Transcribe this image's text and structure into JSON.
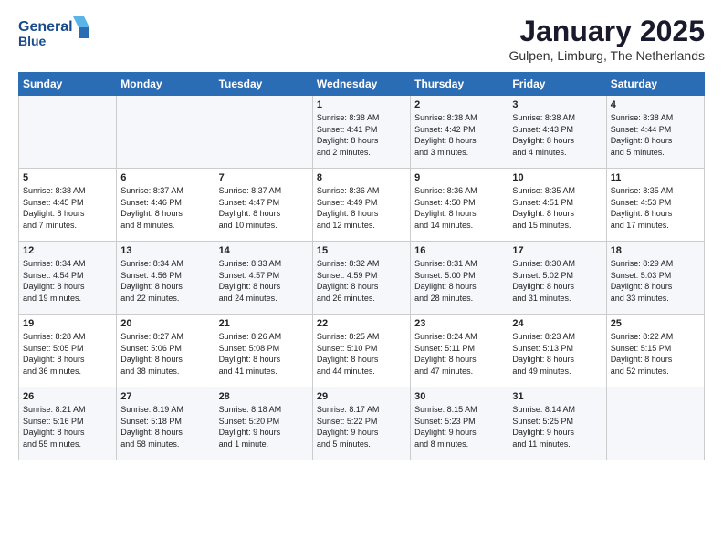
{
  "logo": {
    "line1": "General",
    "line2": "Blue"
  },
  "header": {
    "month": "January 2025",
    "location": "Gulpen, Limburg, The Netherlands"
  },
  "weekdays": [
    "Sunday",
    "Monday",
    "Tuesday",
    "Wednesday",
    "Thursday",
    "Friday",
    "Saturday"
  ],
  "weeks": [
    [
      {
        "day": "",
        "info": ""
      },
      {
        "day": "",
        "info": ""
      },
      {
        "day": "",
        "info": ""
      },
      {
        "day": "1",
        "info": "Sunrise: 8:38 AM\nSunset: 4:41 PM\nDaylight: 8 hours\nand 2 minutes."
      },
      {
        "day": "2",
        "info": "Sunrise: 8:38 AM\nSunset: 4:42 PM\nDaylight: 8 hours\nand 3 minutes."
      },
      {
        "day": "3",
        "info": "Sunrise: 8:38 AM\nSunset: 4:43 PM\nDaylight: 8 hours\nand 4 minutes."
      },
      {
        "day": "4",
        "info": "Sunrise: 8:38 AM\nSunset: 4:44 PM\nDaylight: 8 hours\nand 5 minutes."
      }
    ],
    [
      {
        "day": "5",
        "info": "Sunrise: 8:38 AM\nSunset: 4:45 PM\nDaylight: 8 hours\nand 7 minutes."
      },
      {
        "day": "6",
        "info": "Sunrise: 8:37 AM\nSunset: 4:46 PM\nDaylight: 8 hours\nand 8 minutes."
      },
      {
        "day": "7",
        "info": "Sunrise: 8:37 AM\nSunset: 4:47 PM\nDaylight: 8 hours\nand 10 minutes."
      },
      {
        "day": "8",
        "info": "Sunrise: 8:36 AM\nSunset: 4:49 PM\nDaylight: 8 hours\nand 12 minutes."
      },
      {
        "day": "9",
        "info": "Sunrise: 8:36 AM\nSunset: 4:50 PM\nDaylight: 8 hours\nand 14 minutes."
      },
      {
        "day": "10",
        "info": "Sunrise: 8:35 AM\nSunset: 4:51 PM\nDaylight: 8 hours\nand 15 minutes."
      },
      {
        "day": "11",
        "info": "Sunrise: 8:35 AM\nSunset: 4:53 PM\nDaylight: 8 hours\nand 17 minutes."
      }
    ],
    [
      {
        "day": "12",
        "info": "Sunrise: 8:34 AM\nSunset: 4:54 PM\nDaylight: 8 hours\nand 19 minutes."
      },
      {
        "day": "13",
        "info": "Sunrise: 8:34 AM\nSunset: 4:56 PM\nDaylight: 8 hours\nand 22 minutes."
      },
      {
        "day": "14",
        "info": "Sunrise: 8:33 AM\nSunset: 4:57 PM\nDaylight: 8 hours\nand 24 minutes."
      },
      {
        "day": "15",
        "info": "Sunrise: 8:32 AM\nSunset: 4:59 PM\nDaylight: 8 hours\nand 26 minutes."
      },
      {
        "day": "16",
        "info": "Sunrise: 8:31 AM\nSunset: 5:00 PM\nDaylight: 8 hours\nand 28 minutes."
      },
      {
        "day": "17",
        "info": "Sunrise: 8:30 AM\nSunset: 5:02 PM\nDaylight: 8 hours\nand 31 minutes."
      },
      {
        "day": "18",
        "info": "Sunrise: 8:29 AM\nSunset: 5:03 PM\nDaylight: 8 hours\nand 33 minutes."
      }
    ],
    [
      {
        "day": "19",
        "info": "Sunrise: 8:28 AM\nSunset: 5:05 PM\nDaylight: 8 hours\nand 36 minutes."
      },
      {
        "day": "20",
        "info": "Sunrise: 8:27 AM\nSunset: 5:06 PM\nDaylight: 8 hours\nand 38 minutes."
      },
      {
        "day": "21",
        "info": "Sunrise: 8:26 AM\nSunset: 5:08 PM\nDaylight: 8 hours\nand 41 minutes."
      },
      {
        "day": "22",
        "info": "Sunrise: 8:25 AM\nSunset: 5:10 PM\nDaylight: 8 hours\nand 44 minutes."
      },
      {
        "day": "23",
        "info": "Sunrise: 8:24 AM\nSunset: 5:11 PM\nDaylight: 8 hours\nand 47 minutes."
      },
      {
        "day": "24",
        "info": "Sunrise: 8:23 AM\nSunset: 5:13 PM\nDaylight: 8 hours\nand 49 minutes."
      },
      {
        "day": "25",
        "info": "Sunrise: 8:22 AM\nSunset: 5:15 PM\nDaylight: 8 hours\nand 52 minutes."
      }
    ],
    [
      {
        "day": "26",
        "info": "Sunrise: 8:21 AM\nSunset: 5:16 PM\nDaylight: 8 hours\nand 55 minutes."
      },
      {
        "day": "27",
        "info": "Sunrise: 8:19 AM\nSunset: 5:18 PM\nDaylight: 8 hours\nand 58 minutes."
      },
      {
        "day": "28",
        "info": "Sunrise: 8:18 AM\nSunset: 5:20 PM\nDaylight: 9 hours\nand 1 minute."
      },
      {
        "day": "29",
        "info": "Sunrise: 8:17 AM\nSunset: 5:22 PM\nDaylight: 9 hours\nand 5 minutes."
      },
      {
        "day": "30",
        "info": "Sunrise: 8:15 AM\nSunset: 5:23 PM\nDaylight: 9 hours\nand 8 minutes."
      },
      {
        "day": "31",
        "info": "Sunrise: 8:14 AM\nSunset: 5:25 PM\nDaylight: 9 hours\nand 11 minutes."
      },
      {
        "day": "",
        "info": ""
      }
    ]
  ]
}
